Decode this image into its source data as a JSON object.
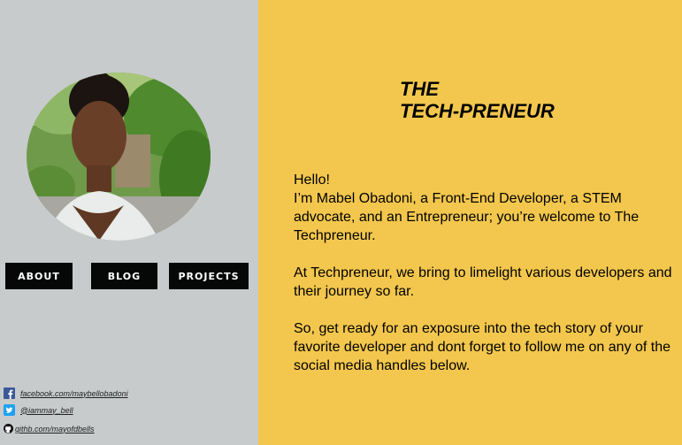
{
  "nav": {
    "about_label": "ABOUT",
    "blog_label": "BLOG",
    "projects_label": "PROJECTS"
  },
  "social": {
    "facebook": "facebook.com/maybellobadoni",
    "twitter": "@iammay_bell",
    "github": "githb.com/mayofdbells"
  },
  "header": {
    "title_line1": "THE",
    "title_line2": "TECH-PRENEUR"
  },
  "bio": {
    "greeting": "Hello!",
    "intro": "I’m Mabel Obadoni, a Front-End Developer, a STEM advocate, and an Entrepreneur; you’re welcome  to The Techpreneur.",
    "mission": "At Techpreneur, we bring to limelight  various developers and their journey so far.",
    "cta": "So, get ready for an exposure into the tech story of your favorite developer and dont forget to follow me on any of the social media handles below."
  },
  "colors": {
    "sidebar_bg": "#c8cbcc",
    "main_bg": "#f3c74d",
    "button_bg": "#050806",
    "facebook": "#3b5998",
    "twitter": "#1da1f2"
  },
  "icons": [
    "facebook-icon",
    "twitter-icon",
    "github-icon"
  ]
}
